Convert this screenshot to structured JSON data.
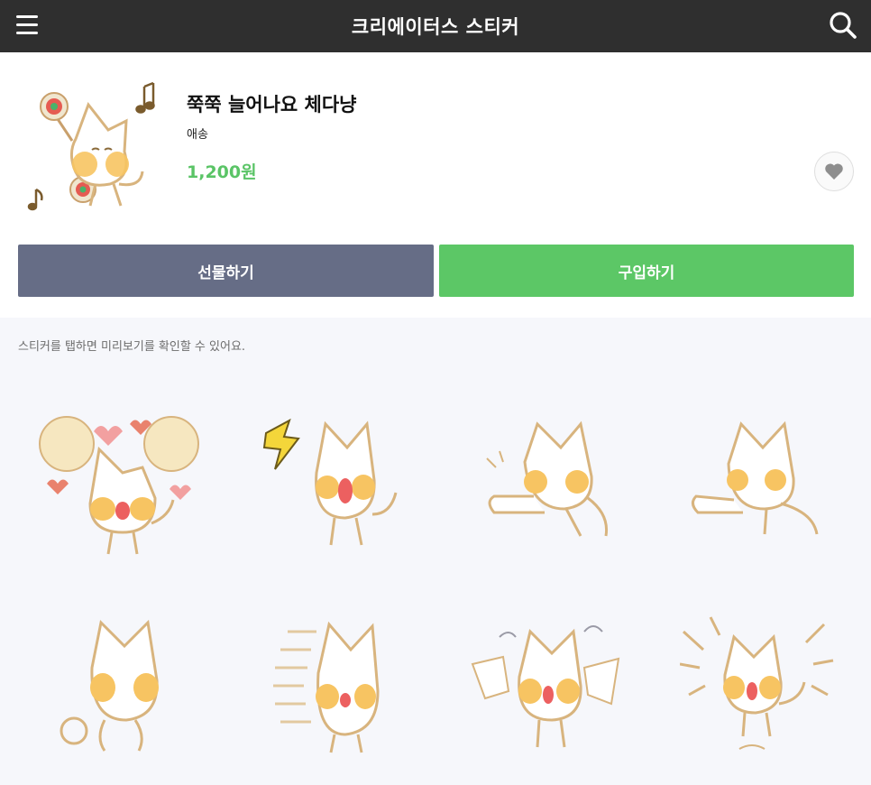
{
  "header": {
    "title": "크리에이터스 스티커",
    "menu_icon": "hamburger-menu-icon",
    "search_icon": "search-icon"
  },
  "product": {
    "name": "쭉쭉 늘어나요 체다냥",
    "author": "애송",
    "price": "1,200원",
    "like_icon": "heart-icon"
  },
  "actions": {
    "gift_label": "선물하기",
    "buy_label": "구입하기"
  },
  "hint": "스티커를 탭하면 미리보기를 확인할 수 있어요.",
  "colors": {
    "header_bg": "#2f2f2f",
    "gift_button": "#666d86",
    "buy_button": "#5cc766",
    "price": "#5ac466",
    "sticker_patch": "#f7c462",
    "sticker_outline": "#d8b47e"
  },
  "stickers": [
    {
      "name": "cat-love-fans"
    },
    {
      "name": "cat-shouting-spark"
    },
    {
      "name": "cat-stretch-arm-left"
    },
    {
      "name": "cat-stretch-arm-left-2"
    },
    {
      "name": "cat-small-wave"
    },
    {
      "name": "cat-speedy-face"
    },
    {
      "name": "cat-flustered"
    },
    {
      "name": "cat-shocked-lines"
    }
  ]
}
